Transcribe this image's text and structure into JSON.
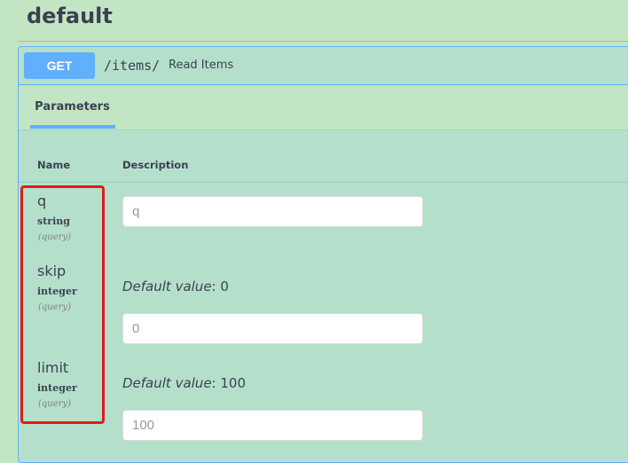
{
  "tag": {
    "title": "default"
  },
  "operation": {
    "method": "GET",
    "path": "/items/",
    "summary": "Read Items"
  },
  "tabs": {
    "parameters": "Parameters"
  },
  "columns": {
    "name": "Name",
    "description": "Description"
  },
  "parameters": [
    {
      "name": "q",
      "type": "string",
      "in": "(query)",
      "placeholder": "q"
    },
    {
      "name": "skip",
      "type": "integer",
      "in": "(query)",
      "default_label": "Default value",
      "default_value": ": 0",
      "placeholder": "0"
    },
    {
      "name": "limit",
      "type": "integer",
      "in": "(query)",
      "default_label": "Default value",
      "default_value": ": 100",
      "placeholder": "100"
    }
  ],
  "colors": {
    "method_get": "#61affe",
    "background": "#c2e5c3",
    "highlight": "#e01b1b"
  }
}
